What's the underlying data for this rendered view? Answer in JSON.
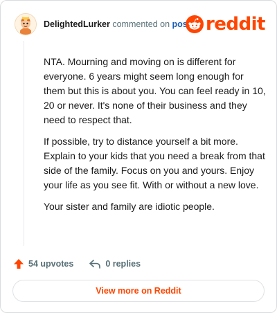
{
  "header": {
    "username": "DelightedLurker",
    "commented_on": "commented on",
    "post_link": "post",
    "brand": "reddit",
    "brand_color": "#ff4500"
  },
  "comment": {
    "paragraphs": [
      "NTA. Mourning and moving on is different for everyone. 6 years might seem long enough for them but this is about you. You can feel ready in 10, 20 or never. It's none of their business and they need to respect that.",
      "If possible, try to distance yourself a bit more. Explain to your kids that you need a break from that side of the family. Focus on you and yours. Enjoy your life as you see fit. With or without a new love.",
      "Your sister and family are idiotic people."
    ]
  },
  "actions": {
    "upvotes": "54 upvotes",
    "replies": "0 replies",
    "upvote_icon": "upvote-arrow-icon",
    "reply_icon": "reply-arrow-icon"
  },
  "footer": {
    "view_more": "View more on Reddit"
  }
}
